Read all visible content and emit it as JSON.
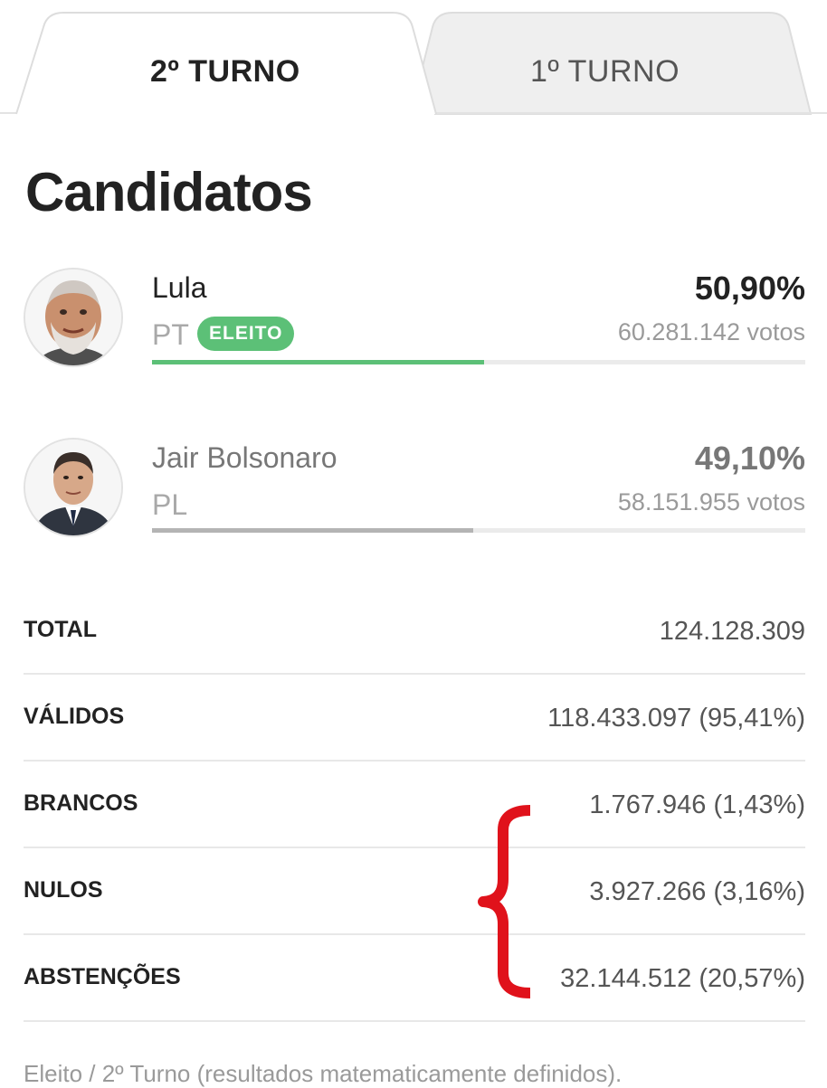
{
  "tabs": [
    {
      "label": "2º TURNO",
      "active": true
    },
    {
      "label": "1º TURNO",
      "active": false
    }
  ],
  "section_title": "Candidatos",
  "candidates": [
    {
      "name": "Lula",
      "party": "PT",
      "badge": "ELEITO",
      "percent": "50,90%",
      "votes": "60.281.142 votos",
      "share": 0.509,
      "bar_color": "#5cc077",
      "name_color": "#222222",
      "percent_color": "#222222"
    },
    {
      "name": "Jair Bolsonaro",
      "party": "PL",
      "badge": "",
      "percent": "49,10%",
      "votes": "58.151.955 votos",
      "share": 0.491,
      "bar_color": "#b4b4b4",
      "name_color": "#777777",
      "percent_color": "#777777"
    }
  ],
  "stats": [
    {
      "label": "TOTAL",
      "value": "124.128.309"
    },
    {
      "label": "VÁLIDOS",
      "value": "118.433.097 (95,41%)"
    },
    {
      "label": "BRANCOS",
      "value": "1.767.946 (1,43%)"
    },
    {
      "label": "NULOS",
      "value": "3.927.266 (3,16%)"
    },
    {
      "label": "ABSTENÇÕES",
      "value": "32.144.512 (20,57%)"
    }
  ],
  "annotation": {
    "icon": "red-curly-brace",
    "color": "#e0121b"
  },
  "footnote": "Eleito / 2º Turno (resultados matematicamente definidos).",
  "colors": {
    "elected_green": "#5cc077",
    "tab_inactive_bg": "#efefef",
    "border": "#e3e3e3"
  }
}
